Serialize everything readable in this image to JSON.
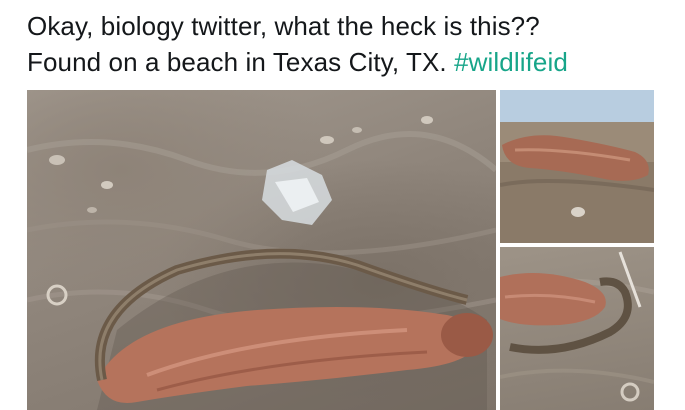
{
  "tweet": {
    "line1": "Okay, biology twitter, what the heck is this??",
    "line2_prefix": "Found on a beach in Texas City, TX. ",
    "hashtag": "#wildlifeid"
  },
  "media": {
    "photos": [
      {
        "label": "creature on sand, close view"
      },
      {
        "label": "creature on beach, wide view"
      },
      {
        "label": "creature on sand, side view"
      }
    ]
  },
  "colors": {
    "text": "#14171a",
    "hashtag": "#17a589",
    "sand": "#8f857b",
    "creature": "#b0705a"
  }
}
